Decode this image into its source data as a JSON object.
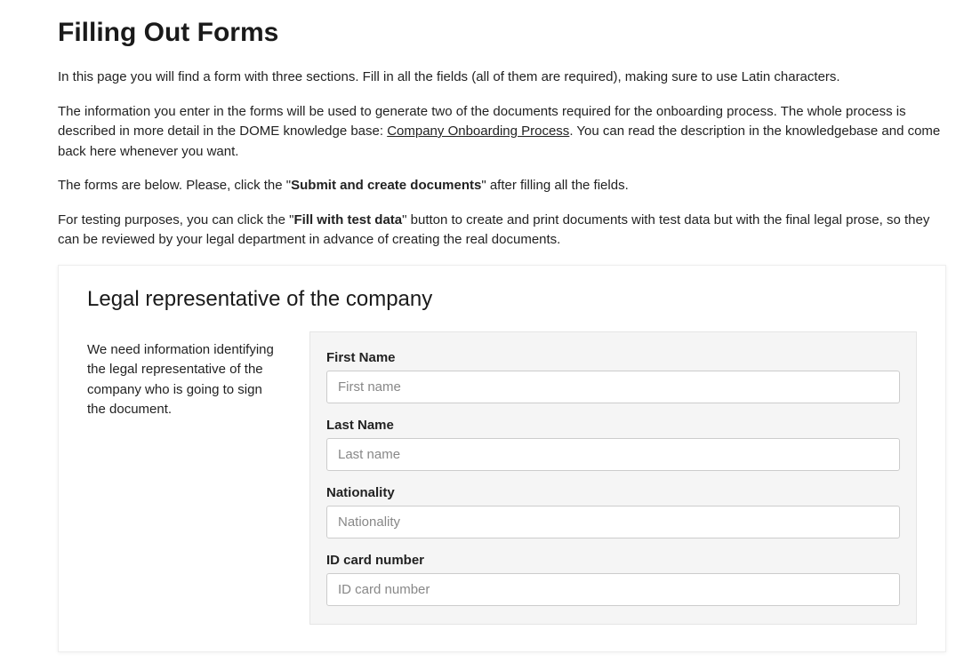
{
  "page": {
    "title": "Filling Out Forms",
    "intro_p1": "In this page you will find a form with three sections. Fill in all the fields (all of them are required), making sure to use Latin characters.",
    "intro_p2_a": "The information you enter in the forms will be used to generate two of the documents required for the onboarding process. The whole process is described in more detail in the DOME knowledge base: ",
    "intro_p2_link": "Company Onboarding Process",
    "intro_p2_b": ". You can read the description in the knowledgebase and come back here whenever you want.",
    "intro_p3_a": "The forms are below. Please, click the \"",
    "intro_p3_bold": "Submit and create documents",
    "intro_p3_b": "\" after filling all the fields.",
    "intro_p4_a": "For testing purposes, you can click the \"",
    "intro_p4_bold": "Fill with test data",
    "intro_p4_b": "\" button to create and print documents with test data but with the final legal prose, so they can be reviewed by your legal department in advance of creating the real documents."
  },
  "form": {
    "section_title": "Legal representative of the company",
    "section_desc": "We need information identifying the legal representative of the company who is going to sign the document.",
    "fields": {
      "first_name": {
        "label": "First Name",
        "placeholder": "First name",
        "value": ""
      },
      "last_name": {
        "label": "Last Name",
        "placeholder": "Last name",
        "value": ""
      },
      "nationality": {
        "label": "Nationality",
        "placeholder": "Nationality",
        "value": ""
      },
      "id_card": {
        "label": "ID card number",
        "placeholder": "ID card number",
        "value": ""
      }
    }
  }
}
